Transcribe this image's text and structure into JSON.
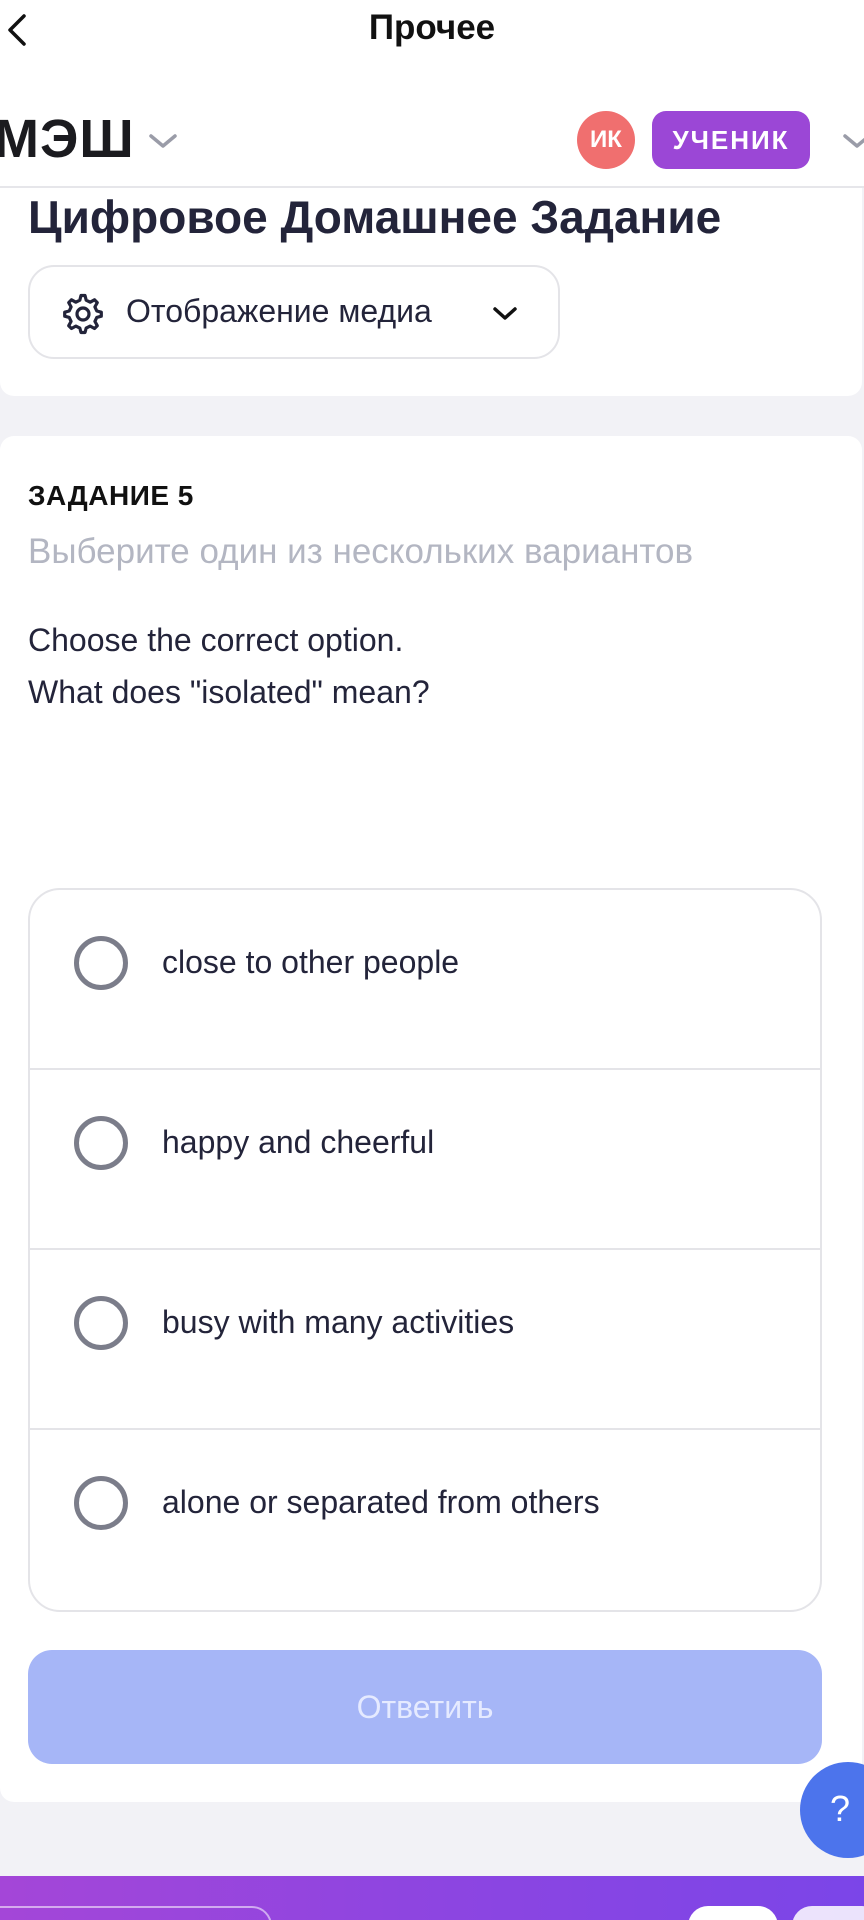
{
  "topbar": {
    "title": "Прочее",
    "back_icon": "chevron-left-icon"
  },
  "header": {
    "logo": "МЭШ",
    "avatar_initials": "ИК",
    "role": "УЧЕНИК",
    "colors": {
      "avatar": "#f06f6f",
      "role_badge": "#9b47d6"
    }
  },
  "page": {
    "title": "Цифровое Домашнее Задание",
    "media_select": {
      "label": "Отображение медиа",
      "icon": "gear-icon"
    }
  },
  "task": {
    "number": "ЗАДАНИЕ 5",
    "instruction": "Выберите один из нескольких вариантов",
    "question_line1": "Choose the correct option.",
    "question_line2": "What does \"isolated\" mean?",
    "options": [
      {
        "label": "close to other people",
        "selected": false
      },
      {
        "label": "happy and cheerful",
        "selected": false
      },
      {
        "label": "busy with many activities",
        "selected": false
      },
      {
        "label": "alone or separated from others",
        "selected": false
      }
    ],
    "submit_label": "Ответить",
    "submit_color": "#a6b6f7"
  },
  "help": {
    "label": "?",
    "color": "#4c74ec"
  }
}
